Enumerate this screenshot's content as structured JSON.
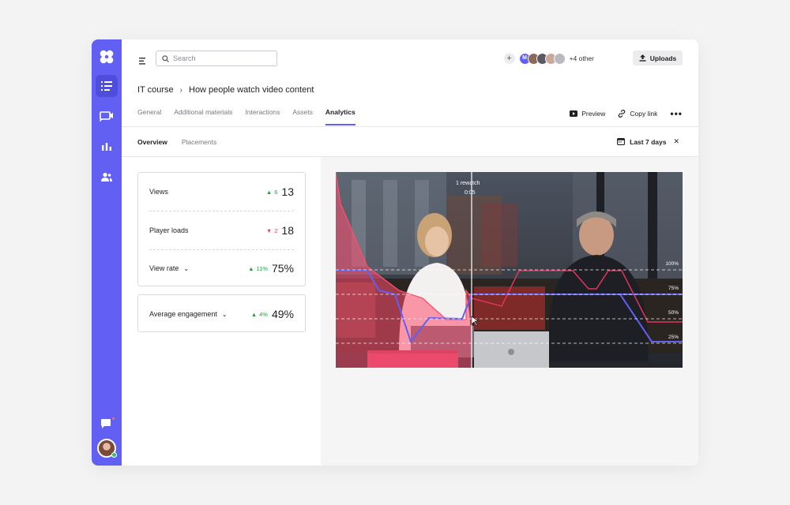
{
  "search": {
    "placeholder": "Search"
  },
  "collaborators": {
    "others_label": "+4 other",
    "avatars": [
      {
        "initial": "M",
        "color": "#6160f2"
      },
      {
        "initial": "",
        "color": "#8a6a58"
      },
      {
        "initial": "",
        "color": "#5a5a66"
      },
      {
        "initial": "",
        "color": "#c9a99a"
      },
      {
        "initial": "",
        "color": "#b9b9c0"
      }
    ]
  },
  "header": {
    "uploads_label": "Uploads"
  },
  "breadcrumb": {
    "parent": "IT course",
    "current": "How people watch video content"
  },
  "tabs": [
    "General",
    "Additional materials",
    "Interactions",
    "Assets",
    "Analytics"
  ],
  "active_tab": "Analytics",
  "tab_actions": {
    "preview": "Preview",
    "copy_link": "Copy link"
  },
  "subtabs": [
    "Overview",
    "Placements"
  ],
  "date_range": {
    "label": "Last 7 days"
  },
  "metrics": {
    "views": {
      "label": "Views",
      "change": "6",
      "direction": "up",
      "value": "13"
    },
    "player_loads": {
      "label": "Player loads",
      "change": "2",
      "direction": "down",
      "value": "18"
    },
    "view_rate": {
      "label": "View rate",
      "change": "11%",
      "direction": "up",
      "value": "75%"
    },
    "engagement": {
      "label": "Average engagement",
      "change": "4%",
      "direction": "up",
      "value": "49%"
    }
  },
  "video": {
    "rewatch_label": "1 rewatch",
    "timestamp": "0:05",
    "levels": [
      "100%",
      "75%",
      "50%",
      "25%"
    ]
  },
  "colors": {
    "accent": "#6160f2",
    "up": "#2f9c45",
    "down": "#e04662"
  }
}
